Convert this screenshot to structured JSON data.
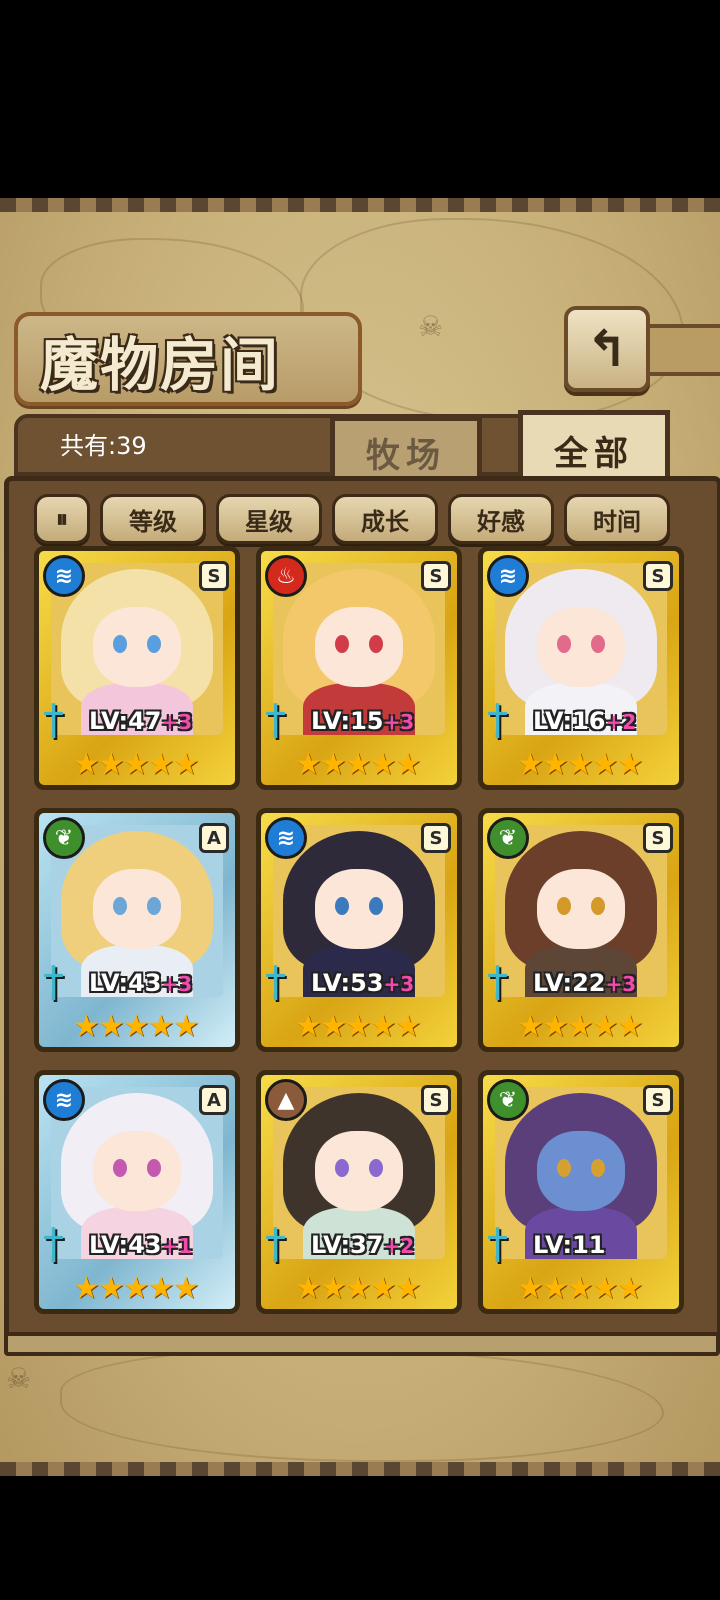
{
  "header": {
    "title": "魔物房间",
    "back_icon": "↰"
  },
  "summary": {
    "count_text": "共有:39"
  },
  "tabs": [
    {
      "label": "牧场",
      "active": false
    },
    {
      "label": "全部",
      "active": true
    }
  ],
  "filters": {
    "toggle_icon": "⏸",
    "sort": [
      "等级",
      "星级",
      "成长",
      "好感",
      "时间"
    ]
  },
  "cards": [
    {
      "element": "water",
      "rank": "S",
      "level": "LV:47",
      "bonus": "+3",
      "stars": "★★★★★",
      "frame": "gold"
    },
    {
      "element": "fire",
      "rank": "S",
      "level": "LV:15",
      "bonus": "+3",
      "stars": "★★★★★",
      "frame": "gold"
    },
    {
      "element": "water",
      "rank": "S",
      "level": "LV:16",
      "bonus": "+2",
      "stars": "★★★★★",
      "frame": "gold"
    },
    {
      "element": "wood",
      "rank": "A",
      "level": "LV:43",
      "bonus": "+3",
      "stars": "★★★★★",
      "frame": "blue"
    },
    {
      "element": "water",
      "rank": "S",
      "level": "LV:53",
      "bonus": "+3",
      "stars": "★★★★★",
      "frame": "gold"
    },
    {
      "element": "wood",
      "rank": "S",
      "level": "LV:22",
      "bonus": "+3",
      "stars": "★★★★★",
      "frame": "gold"
    },
    {
      "element": "water",
      "rank": "A",
      "level": "LV:43",
      "bonus": "+1",
      "stars": "★★★★★",
      "frame": "blue"
    },
    {
      "element": "earth",
      "rank": "S",
      "level": "LV:37",
      "bonus": "+2",
      "stars": "★★★★★",
      "frame": "gold"
    },
    {
      "element": "wood",
      "rank": "S",
      "level": "LV:11",
      "bonus": "",
      "stars": "★★★★★",
      "frame": "gold"
    }
  ],
  "colors": {
    "water": "#1f7dd6",
    "fire": "#d42a1e",
    "wood": "#3f8f2d",
    "earth": "#8a5a3a",
    "gold_frame": "#f7dc4a",
    "blue_frame": "#b9e3f2",
    "panel": "#6a4d2f"
  }
}
